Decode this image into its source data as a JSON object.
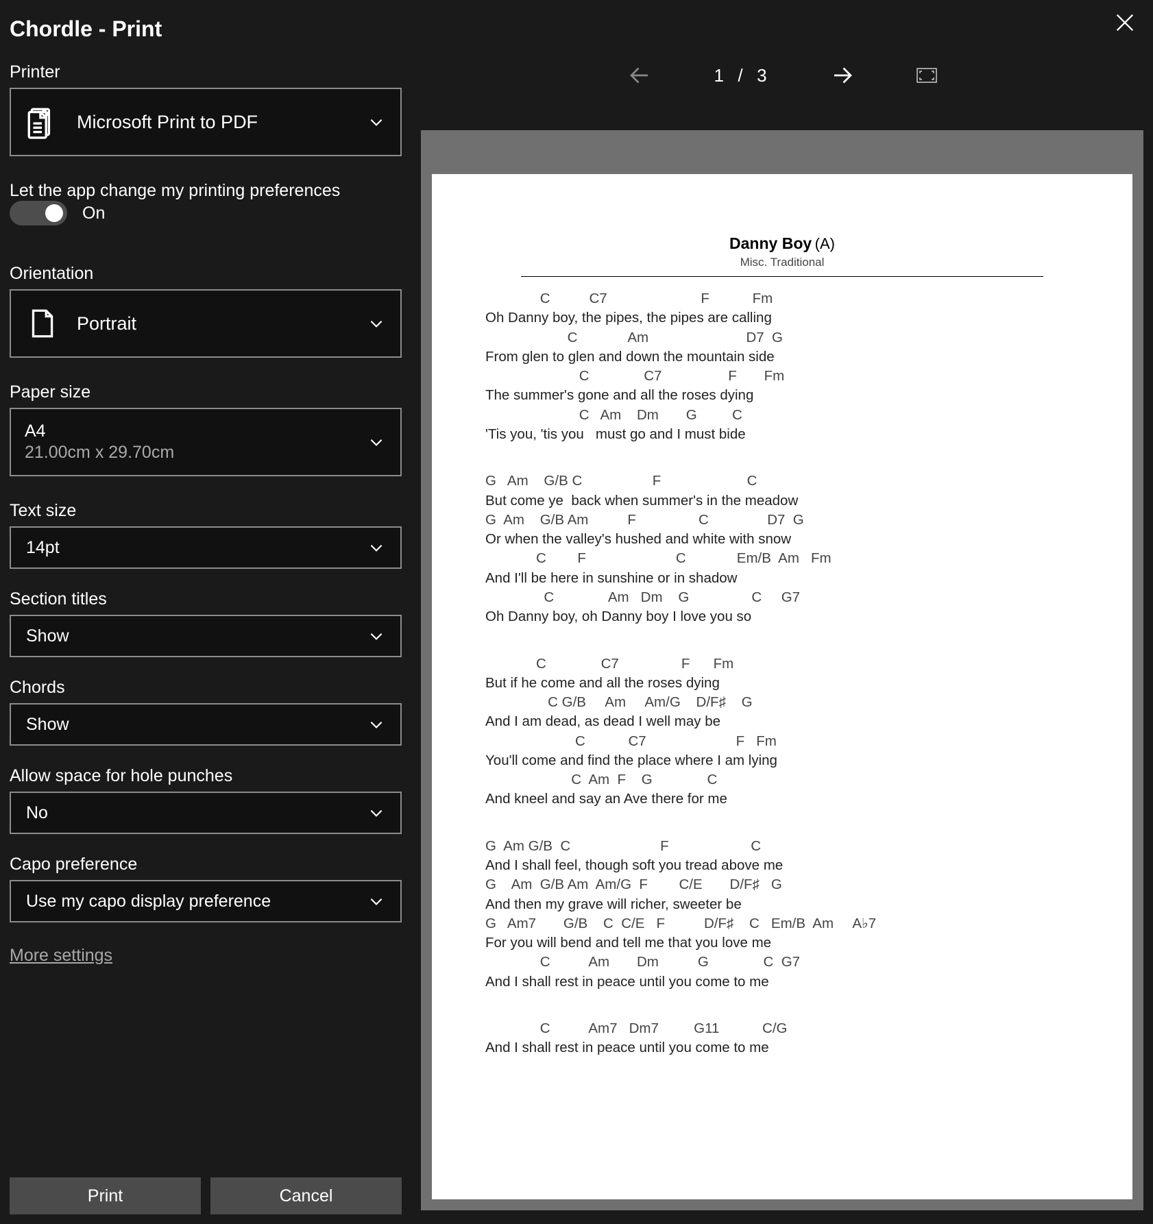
{
  "title": "Chordle - Print",
  "printer": {
    "label": "Printer",
    "value": "Microsoft Print to PDF"
  },
  "appPrefs": {
    "label": "Let the app change my printing preferences",
    "state": "On"
  },
  "orientation": {
    "label": "Orientation",
    "value": "Portrait"
  },
  "paper": {
    "label": "Paper size",
    "value": "A4",
    "sub": "21.00cm x 29.70cm"
  },
  "textsize": {
    "label": "Text size",
    "value": "14pt"
  },
  "sectiontitles": {
    "label": "Section titles",
    "value": "Show"
  },
  "chords": {
    "label": "Chords",
    "value": "Show"
  },
  "holepunch": {
    "label": "Allow space for hole punches",
    "value": "No"
  },
  "capo": {
    "label": "Capo preference",
    "value": "Use my capo display preference"
  },
  "moresettings": "More settings",
  "buttons": {
    "print": "Print",
    "cancel": "Cancel"
  },
  "pager": {
    "current": "1",
    "sep": "/",
    "total": "3"
  },
  "song": {
    "title": "Danny Boy",
    "key": "(A)",
    "subtitle": "Misc. Traditional",
    "verses": [
      [
        {
          "c": "              C          C7                        F           Fm",
          "l": "Oh Danny boy, the pipes, the pipes are calling"
        },
        {
          "c": "                     C             Am                         D7  G",
          "l": "From glen to glen and down the mountain side"
        },
        {
          "c": "                        C              C7                 F       Fm",
          "l": "The summer's gone and all the roses dying"
        },
        {
          "c": "                        C   Am    Dm       G         C",
          "l": "'Tis you, 'tis you   must go and I must bide"
        }
      ],
      [
        {
          "c": "G   Am    G/B C                  F                      C",
          "l": "But come ye  back when summer's in the meadow"
        },
        {
          "c": "G  Am    G/B Am          F                C               D7  G",
          "l": "Or when the valley's hushed and white with snow"
        },
        {
          "c": "             C        F                       C             Em/B  Am   Fm",
          "l": "And I'll be here in sunshine or in shadow"
        },
        {
          "c": "               C              Am   Dm    G                C     G7",
          "l": "Oh Danny boy, oh Danny boy I love you so"
        }
      ],
      [
        {
          "c": "             C              C7                F      Fm",
          "l": "But if he come and all the roses dying"
        },
        {
          "c": "                C G/B     Am     Am/G    D/F♯    G",
          "l": "And I am dead, as dead I well may be"
        },
        {
          "c": "                       C           C7                       F   Fm",
          "l": "You'll come and find the place where I am lying"
        },
        {
          "c": "                      C  Am  F    G              C",
          "l": "And kneel and say an Ave there for me"
        }
      ],
      [
        {
          "c": "G  Am G/B  C                       F                     C",
          "l": "And I shall feel, though soft you tread above me"
        },
        {
          "c": "G    Am  G/B Am  Am/G  F        C/E       D/F♯   G",
          "l": "And then my grave will richer, sweeter be"
        },
        {
          "c": "G   Am7       G/B    C  C/E   F          D/F♯    C   Em/B  Am     A♭7",
          "l": "For you will bend and tell me that you love me"
        },
        {
          "c": "              C          Am       Dm          G              C  G7",
          "l": "And I shall rest in peace until you come to me"
        }
      ],
      [
        {
          "c": "              C          Am7   Dm7         G11           C/G",
          "l": "And I shall rest in peace until you come to me"
        }
      ]
    ]
  }
}
